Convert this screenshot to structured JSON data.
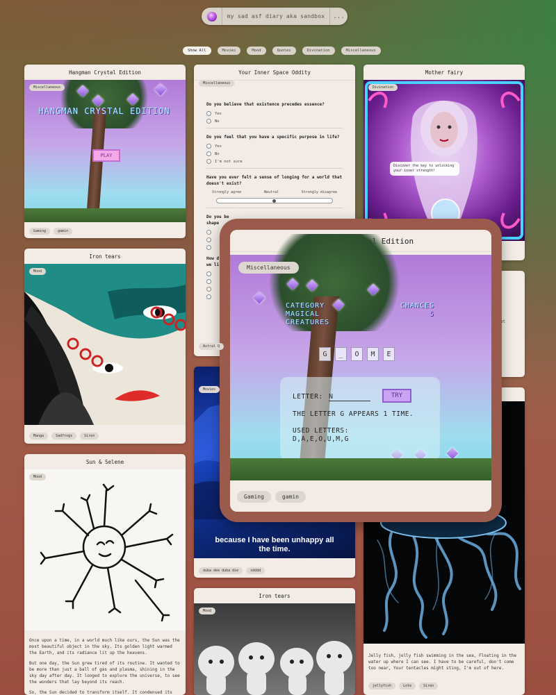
{
  "header": {
    "title": "my sad asf diary aka sandbox",
    "more_label": "..."
  },
  "filters": [
    "Show All",
    "Movies",
    "Mood",
    "Quotes",
    "Divination",
    "Miscellaneous"
  ],
  "cards": {
    "hangman": {
      "title": "Hangman Crystal Edition",
      "category": "Miscellaneous",
      "game_title": "HANGMAN CRYSTAL EDITION",
      "play_label": "PLAY",
      "tags": [
        "Gaming",
        "gamin"
      ]
    },
    "quiz": {
      "title": "Your Inner Space Oddity",
      "category": "Miscellaneous",
      "q1": "Do you believe that existence precedes essence?",
      "q1_opts": [
        "Yes",
        "No"
      ],
      "q2": "Do you feel that you have a specific purpose in life?",
      "q2_opts": [
        "Yes",
        "No",
        "I'm not sure"
      ],
      "q3": "Have you ever felt a sense of longing for a world that doesn't exist?",
      "q3_scale": [
        "Strongly agree",
        "Neutral",
        "Strongly disagree"
      ],
      "q4": "Do you be",
      "q4_line2": "shape",
      "q5": "How d",
      "q5_line2": "we li",
      "footer_tag": "Astral Q"
    },
    "mother_fairy": {
      "title": "Mother fairy",
      "category": "Divination",
      "caption": "Discover the key to unlocking your inner strength!"
    },
    "iron_tears_1": {
      "title": "Iron tears",
      "category": "Mood",
      "tags": [
        "Manga",
        "Sadfrogs",
        "Siren"
      ]
    },
    "movie": {
      "category": "Movies",
      "subtitle": "because I have been unhappy all the time.",
      "tags": [
        "duba dee duba die",
        "xdddd"
      ]
    },
    "sun_selene": {
      "title": "Sun & Selene",
      "category": "Mood",
      "p1": "Once upon a time, in a world much like ours, the Sun was the most beautiful object in the sky. Its golden light warmed the Earth, and its radiance lit up the heavens.",
      "p2": "But one day, the Sun grew tired of its routine. It wanted to be more than just a ball of gas and plasma, shining in the sky day after day. It longed to explore the universe, to see the wonders that lay beyond its reach.",
      "p3": "So, the Sun decided to transform itself. It condensed its energy into a single point and burst forth as a beam of"
    },
    "iron_tears_2": {
      "title": "Iron tears",
      "category": "Mood"
    },
    "jellyfish": {
      "text": "Jelly fish, jelly fish swimming in the sea, Floating in the water up where I can see. I have to be careful, don't come too near, Your tentacles might sting, I'm out of here.",
      "tags": [
        "jellyfish",
        "Lote",
        "Siren"
      ]
    },
    "right_partial": {
      "text": "nt"
    }
  },
  "modal": {
    "title": "Hangman Crystal Edition",
    "category": "Miscellaneous",
    "category_label": "CATEGORY",
    "category_value_1": "MAGICAL",
    "category_value_2": "CREATURES",
    "chances_label": "CHANCES",
    "chances_value": "5",
    "word_letters": [
      "G",
      "_",
      "O",
      "M",
      "E"
    ],
    "letter_label": "LETTER:",
    "letter_value": "N",
    "try_label": "TRY",
    "message": "THE LETTER G APPEARS 1 TIME.",
    "used_label": "USED LETTERS:",
    "used_value": "D,A,E,O,U,M,G",
    "tags": [
      "Gaming",
      "gamin"
    ]
  }
}
